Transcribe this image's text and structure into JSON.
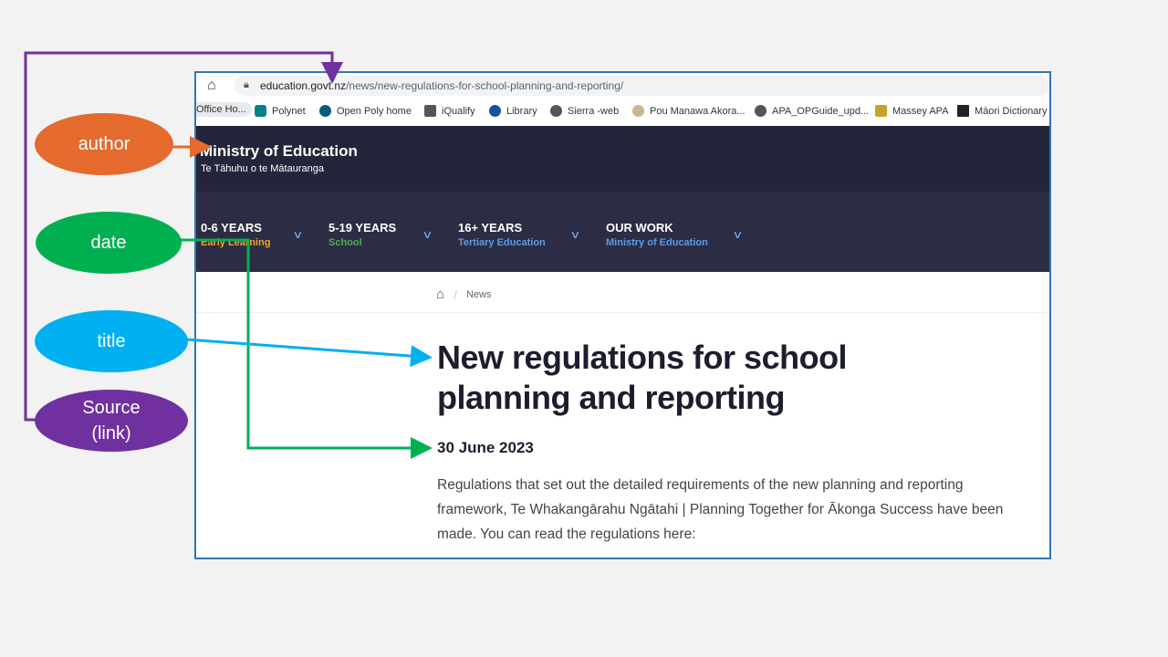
{
  "browser": {
    "url_host": "education.govt.nz",
    "url_path": "/news/new-regulations-for-school-planning-and-reporting/",
    "bookmarks": [
      {
        "label": "Office Ho...",
        "icon": "office-icon",
        "color": "#e8eaed"
      },
      {
        "label": "Polynet",
        "icon": "sharepoint-icon",
        "color": "#038387"
      },
      {
        "label": "Open Poly home",
        "icon": "open-poly-icon",
        "color": "#0a5a7a"
      },
      {
        "label": "iQualify",
        "icon": "iqualify-icon",
        "color": "#555555"
      },
      {
        "label": "Library",
        "icon": "library-icon",
        "color": "#1b4f9c"
      },
      {
        "label": "Sierra -web",
        "icon": "globe-icon",
        "color": "#555555"
      },
      {
        "label": "Pou Manawa Akora...",
        "icon": "koru-icon",
        "color": "#b0a070"
      },
      {
        "label": "APA_OPGuide_upd...",
        "icon": "globe-icon",
        "color": "#555555"
      },
      {
        "label": "Massey APA",
        "icon": "massey-crest-icon",
        "color": "#c9a227"
      },
      {
        "label": "Māori Dictionary",
        "icon": "maori-dictionary-icon",
        "color": "#222222"
      }
    ]
  },
  "site": {
    "brand": "Ministry of Education",
    "brand_sub": "Te Tāhuhu o te Mātauranga",
    "nav": [
      {
        "title": "0-6 YEARS",
        "sub": "Early Learning",
        "sub_color": "#f0a030"
      },
      {
        "title": "5-19 YEARS",
        "sub": "School",
        "sub_color": "#4caf50"
      },
      {
        "title": "16+ YEARS",
        "sub": "Tertiary Education",
        "sub_color": "#5b9bea"
      },
      {
        "title": "OUR WORK",
        "sub": "Ministry of Education",
        "sub_color": "#5b9bea"
      }
    ],
    "breadcrumb": {
      "current": "News"
    }
  },
  "article": {
    "title": "New regulations for school planning and reporting",
    "date": "30 June 2023",
    "body": "Regulations that set out the detailed requirements of the new planning and reporting framework, Te Whakangārahu Ngātahi | Planning Together for Ākonga Success have been made. You can read the regulations here:"
  },
  "annotations": {
    "author": {
      "label": "author",
      "color": "#e46a2e"
    },
    "date": {
      "label": "date",
      "color": "#00b050"
    },
    "title": {
      "label": "title",
      "color": "#00b0f0"
    },
    "source": {
      "label": "Source\n(link)",
      "line1": "Source",
      "line2": "(link)",
      "color": "#7030a0"
    }
  }
}
